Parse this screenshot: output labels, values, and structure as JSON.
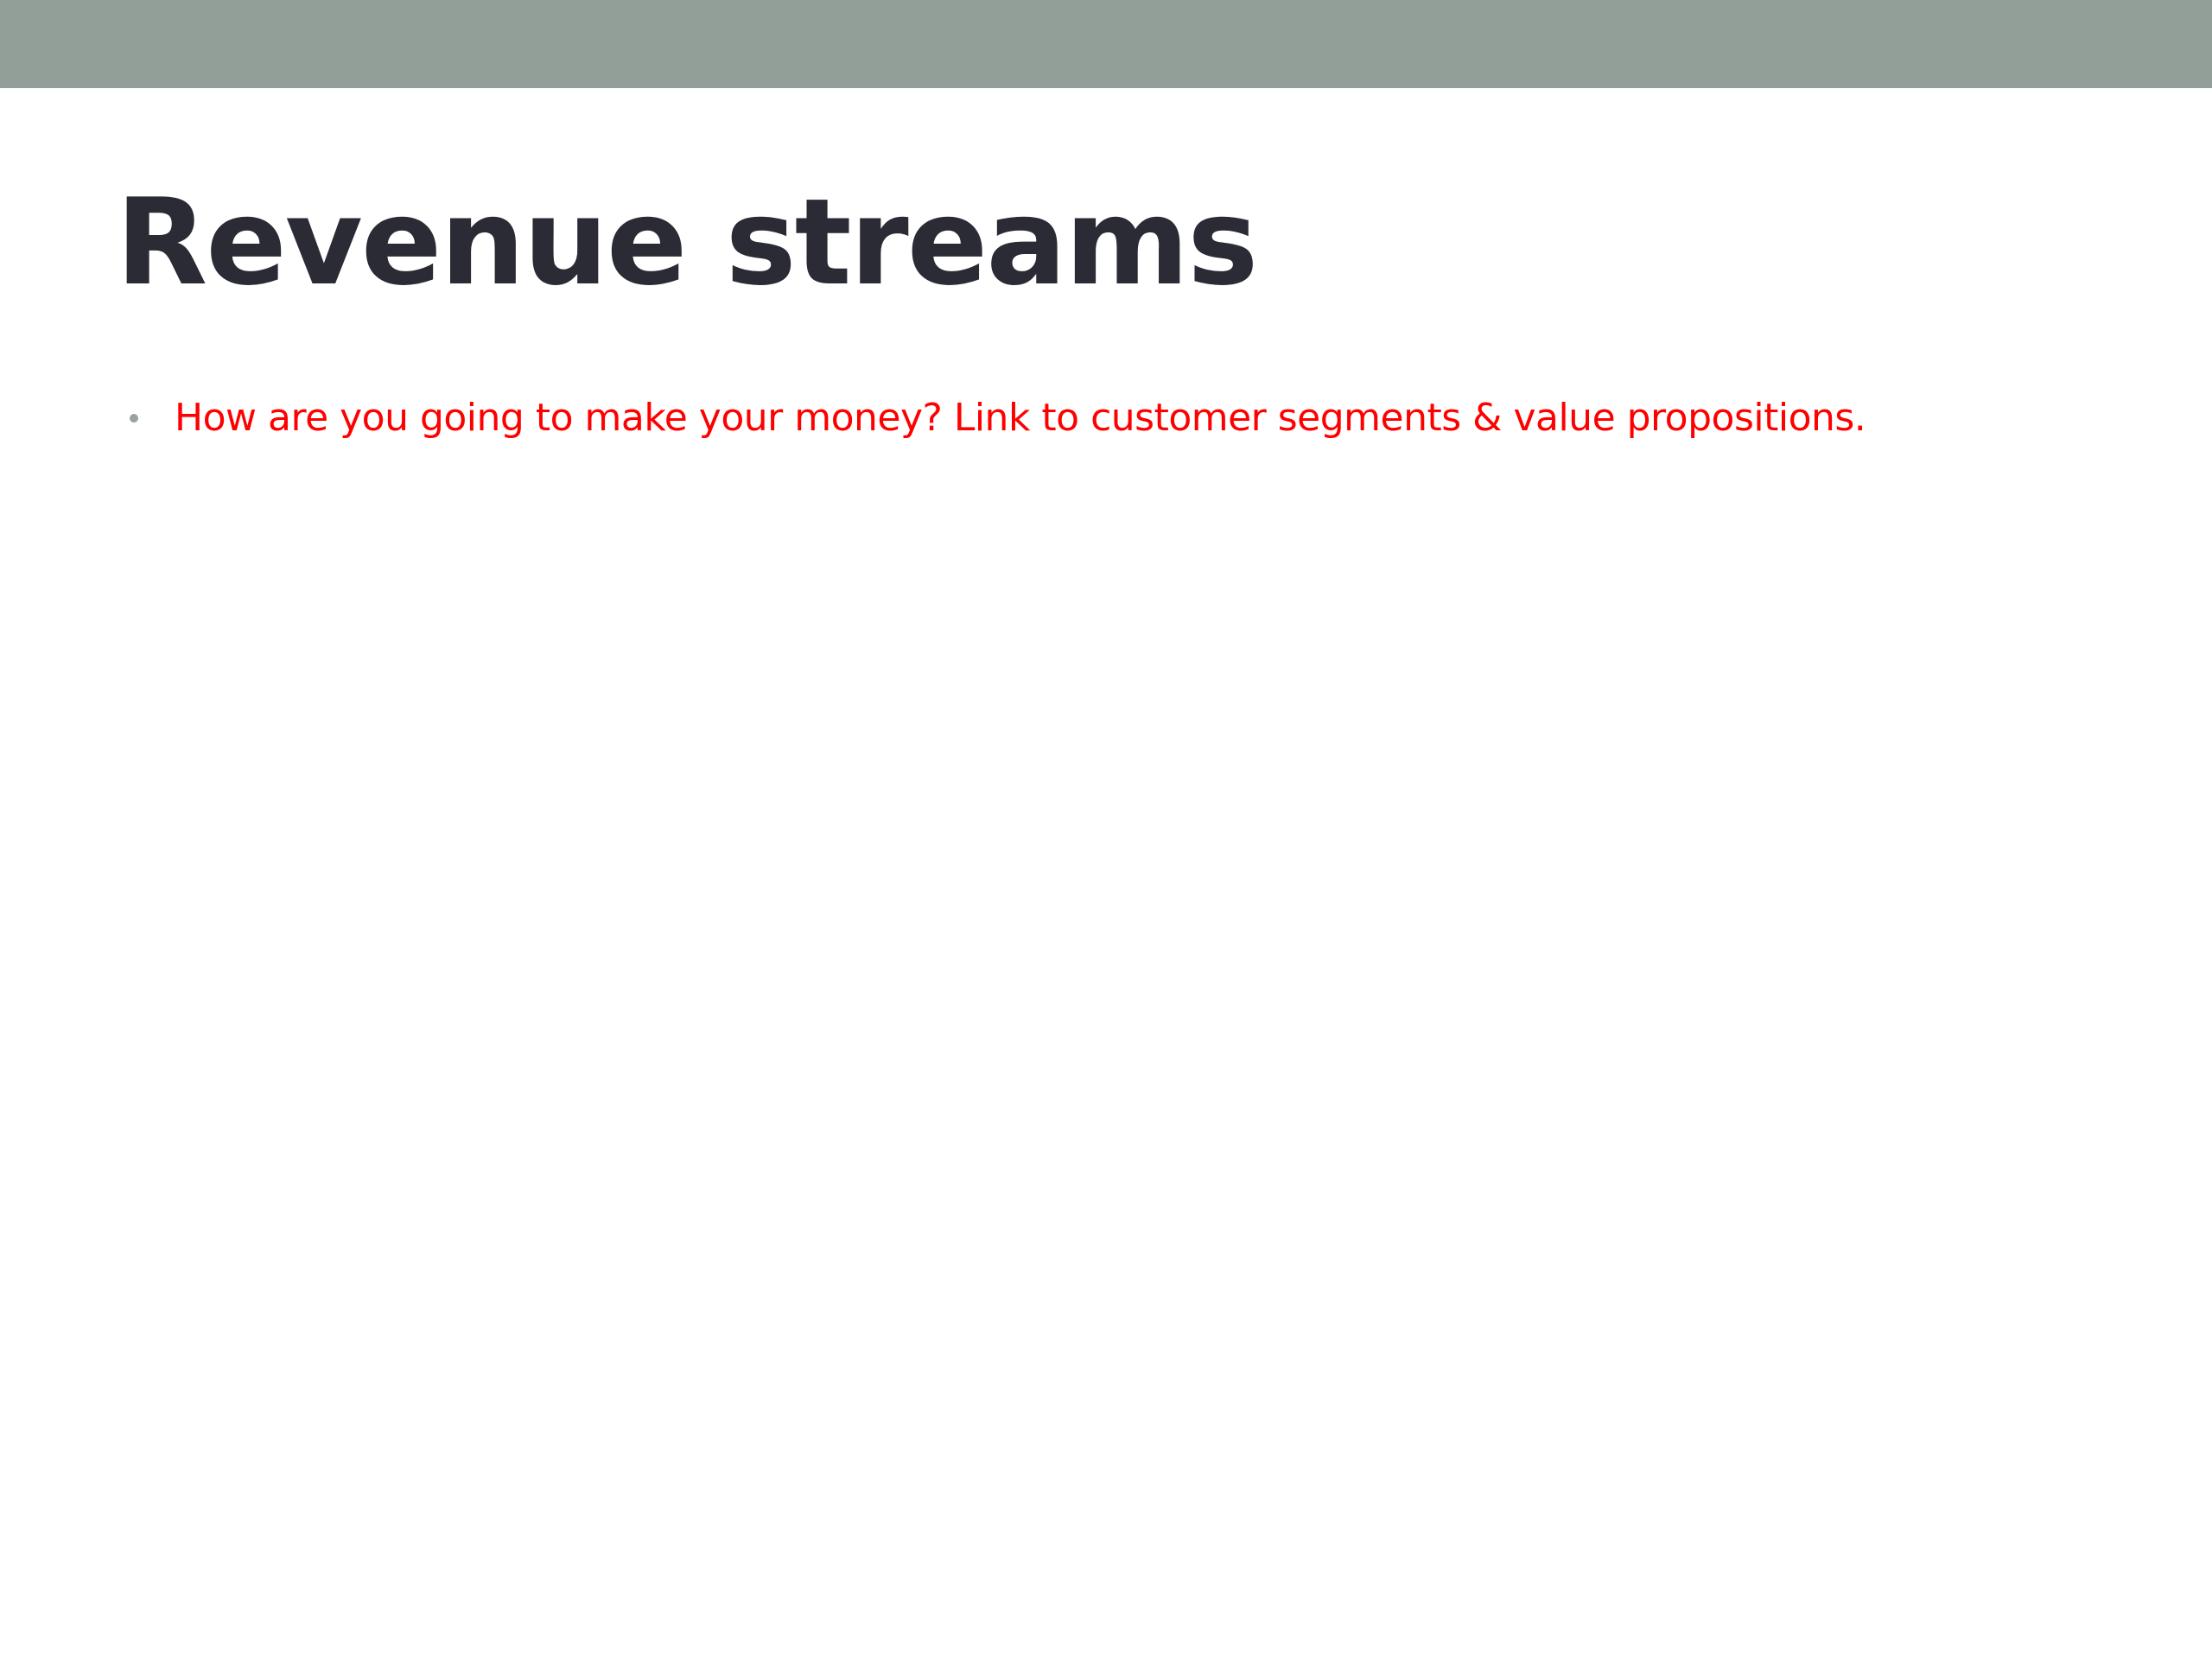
{
  "slide": {
    "title": "Revenue streams",
    "bullets": [
      "How are you going to make your money? Link to customer segments & value propositions."
    ]
  },
  "colors": {
    "top_band": "#919f98",
    "title": "#2a2b35",
    "bullet_text": "#ff0000",
    "bullet_mark": "#9aa39e",
    "background": "#ffffff"
  }
}
